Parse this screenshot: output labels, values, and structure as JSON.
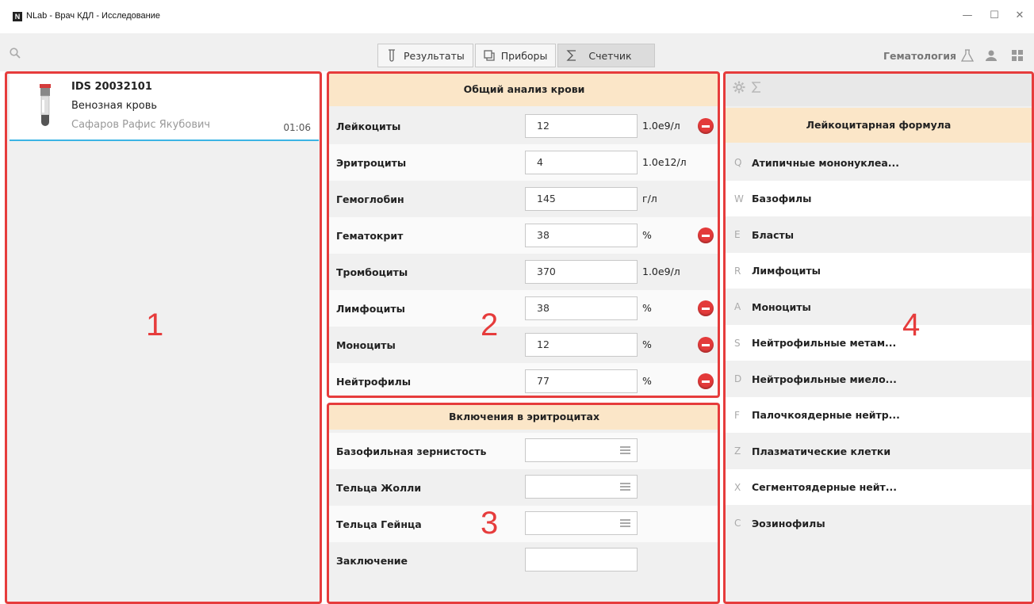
{
  "window": {
    "logo": "N",
    "title": "NLab - Врач КДЛ - Исследование",
    "controls": [
      "—",
      "☐",
      "✕"
    ]
  },
  "toolbar": {
    "tabs": [
      {
        "label": "Результаты",
        "icon": "test-tube-icon"
      },
      {
        "label": "Приборы",
        "icon": "copy-icon"
      },
      {
        "label": "Счетчик",
        "icon": "sigma-icon"
      }
    ],
    "active_tab": "Счетчик",
    "department": "Гематология"
  },
  "sample": {
    "id": "IDS 20032101",
    "type": "Венозная кровь",
    "patient": "Сафаров Рафис Якубович",
    "time": "01:06"
  },
  "cbc": {
    "title": "Общий анализ крови",
    "rows": [
      {
        "label": "Лейкоциты",
        "value": "12",
        "unit": "1.0e9/л",
        "flag": true
      },
      {
        "label": "Эритроциты",
        "value": "4",
        "unit": "1.0e12/л",
        "flag": false
      },
      {
        "label": "Гемоглобин",
        "value": "145",
        "unit": "г/л",
        "flag": false
      },
      {
        "label": "Гематокрит",
        "value": "38",
        "unit": "%",
        "flag": true
      },
      {
        "label": "Тромбоциты",
        "value": "370",
        "unit": "1.0e9/л",
        "flag": false
      },
      {
        "label": "Лимфоциты",
        "value": "38",
        "unit": "%",
        "flag": true
      },
      {
        "label": "Моноциты",
        "value": "12",
        "unit": "%",
        "flag": true
      },
      {
        "label": "Нейтрофилы",
        "value": "77",
        "unit": "%",
        "flag": true
      }
    ]
  },
  "inclusions": {
    "title": "Включения в эритроцитах",
    "rows": [
      {
        "label": "Базофильная зернистость",
        "value": ""
      },
      {
        "label": "Тельца Жолли",
        "value": ""
      },
      {
        "label": "Тельца Гейнца",
        "value": ""
      },
      {
        "label": "Заключение",
        "value": ""
      }
    ]
  },
  "formula": {
    "title": "Лейкоцитарная формула",
    "rows": [
      {
        "key": "Q",
        "name": "Атипичные мононуклеа..."
      },
      {
        "key": "W",
        "name": "Базофилы"
      },
      {
        "key": "E",
        "name": "Бласты"
      },
      {
        "key": "R",
        "name": "Лимфоциты"
      },
      {
        "key": "A",
        "name": "Моноциты"
      },
      {
        "key": "S",
        "name": "Нейтрофильные метам..."
      },
      {
        "key": "D",
        "name": "Нейтрофильные миело..."
      },
      {
        "key": "F",
        "name": "Палочкоядерные нейтр..."
      },
      {
        "key": "Z",
        "name": "Плазматические клетки"
      },
      {
        "key": "X",
        "name": "Сегментоядерные нейт..."
      },
      {
        "key": "C",
        "name": "Эозинофилы"
      }
    ]
  },
  "annotations": [
    "1",
    "2",
    "3",
    "4"
  ],
  "colors": {
    "annotation_red": "#e63c3c",
    "header_bg": "#fbe6c8",
    "selection_blue": "#3bb4e5",
    "flag_red": "#e33a3a"
  }
}
